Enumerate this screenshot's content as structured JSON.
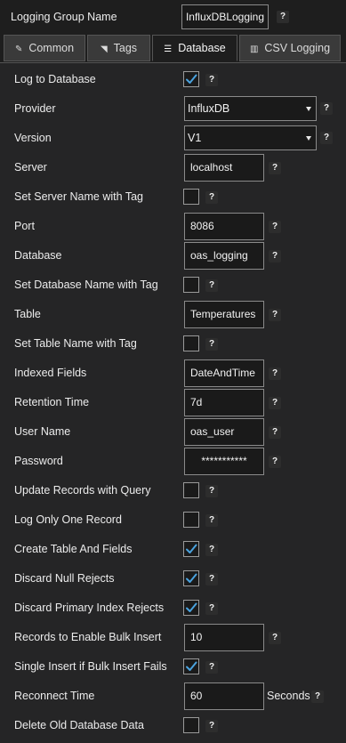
{
  "header": {
    "label": "Logging Group Name",
    "value": "InfluxDBLogging",
    "help": "?"
  },
  "tabs": [
    {
      "label": "Common",
      "icon": "wrench-icon",
      "glyph": "✎",
      "active": false
    },
    {
      "label": "Tags",
      "icon": "tag-icon",
      "glyph": "◥",
      "active": false
    },
    {
      "label": "Database",
      "icon": "database-icon",
      "glyph": "☰",
      "active": true
    },
    {
      "label": "CSV Logging",
      "icon": "csv-icon",
      "glyph": "▥",
      "active": false
    }
  ],
  "fields": {
    "log_to_database": {
      "label": "Log to Database",
      "checked": true
    },
    "provider": {
      "label": "Provider",
      "value": "InfluxDB"
    },
    "version": {
      "label": "Version",
      "value": "V1"
    },
    "server": {
      "label": "Server",
      "value": "localhost"
    },
    "server_with_tag": {
      "label": "Set Server Name with Tag",
      "checked": false
    },
    "port": {
      "label": "Port",
      "value": "8086"
    },
    "database": {
      "label": "Database",
      "value": "oas_logging"
    },
    "database_with_tag": {
      "label": "Set Database Name with Tag",
      "checked": false
    },
    "table": {
      "label": "Table",
      "value": "Temperatures"
    },
    "table_with_tag": {
      "label": "Set Table Name with Tag",
      "checked": false
    },
    "indexed_fields": {
      "label": "Indexed Fields",
      "value": "DateAndTime"
    },
    "retention_time": {
      "label": "Retention Time",
      "value": "7d"
    },
    "user_name": {
      "label": "User Name",
      "value": "oas_user"
    },
    "password": {
      "label": "Password",
      "value": "***********"
    },
    "update_with_query": {
      "label": "Update Records with Query",
      "checked": false
    },
    "log_only_one": {
      "label": "Log Only One Record",
      "checked": false
    },
    "create_table": {
      "label": "Create Table And Fields",
      "checked": true
    },
    "discard_null": {
      "label": "Discard Null Rejects",
      "checked": true
    },
    "discard_primary": {
      "label": "Discard Primary Index Rejects",
      "checked": true
    },
    "bulk_insert": {
      "label": "Records to Enable Bulk Insert",
      "value": "10"
    },
    "single_insert": {
      "label": "Single Insert if Bulk Insert Fails",
      "checked": true
    },
    "reconnect_time": {
      "label": "Reconnect Time",
      "value": "60",
      "unit": "Seconds"
    },
    "delete_old": {
      "label": "Delete Old Database Data",
      "checked": false
    }
  },
  "help_text": "?",
  "colors": {
    "background": "#252526",
    "header": "#1e1e1e",
    "checkmark": "#4aa3df",
    "border": "#8a8a8a"
  }
}
